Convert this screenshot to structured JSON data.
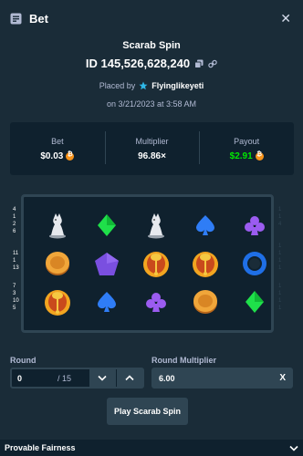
{
  "header": {
    "title": "Bet",
    "icon": "receipt-icon",
    "close_icon": "close-icon"
  },
  "bet": {
    "game": "Scarab Spin",
    "id": "ID 145,526,628,240",
    "placed_by_prefix": "Placed by",
    "user": "Flyinglikeyeti",
    "date": "on 3/21/2023 at 3:58 AM"
  },
  "stats": {
    "bet_label": "Bet",
    "bet_value": "$0.03",
    "multiplier_label": "Multiplier",
    "multiplier_value": "96.86×",
    "payout_label": "Payout",
    "payout_value": "$2.91",
    "payout_color": "#00e701"
  },
  "reels": {
    "rows": [
      [
        "pawn",
        "diamond",
        "pawn",
        "spade",
        "club"
      ],
      [
        "coin",
        "pentagon",
        "scarab",
        "scarab",
        "ring"
      ],
      [
        "scarab",
        "spade",
        "club",
        "coin",
        "diamond"
      ]
    ],
    "left_numbers": [
      [
        "4",
        "1",
        "2",
        "6"
      ],
      [
        "11",
        "1",
        "13"
      ],
      [
        "7",
        "3",
        "10",
        "5"
      ]
    ],
    "right_numbers": [
      [
        "1",
        "1",
        "4"
      ],
      [
        "1",
        "1",
        "1",
        "1"
      ],
      [
        "1",
        "1",
        "1",
        "1"
      ]
    ]
  },
  "round": {
    "label": "Round",
    "value": "0",
    "total": "/ 15"
  },
  "multiplier_field": {
    "label": "Round Multiplier",
    "value": "6.00",
    "clear": "X"
  },
  "play_button": "Play Scarab Spin",
  "fairness": {
    "label": "Provable Fairness"
  },
  "colors": {
    "background": "#1a2c38",
    "panel": "#0f212e",
    "border": "#2f4553",
    "muted": "#b1bad3",
    "accent_green": "#00e701",
    "coin": "#f7931a"
  }
}
